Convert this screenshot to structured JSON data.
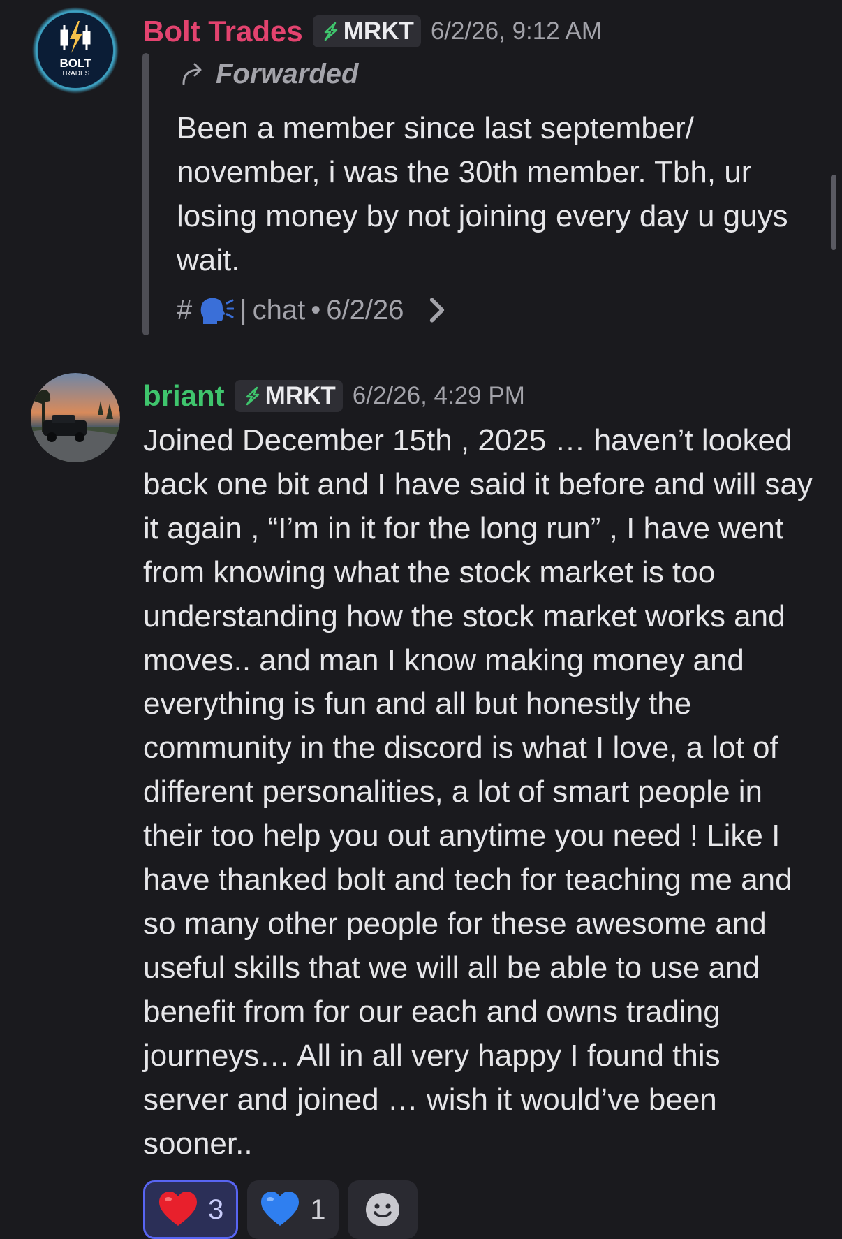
{
  "messages": [
    {
      "author": "Bolt Trades",
      "tag": "MRKT",
      "timestamp": "6/2/26, 9:12 AM",
      "avatar": {
        "line1": "BOLT",
        "line2": "TRADES"
      },
      "forwarded": {
        "label": "Forwarded",
        "body": "Been a member since last september/ november, i was the 30th member. Tbh, ur losing money by not joining every day u guys wait.",
        "source": {
          "prefix": "#",
          "separator": "|",
          "channel": "chat",
          "dot": "•",
          "date": "6/2/26"
        }
      }
    },
    {
      "author": "briant",
      "tag": "MRKT",
      "timestamp": "6/2/26, 4:29 PM",
      "body": "Joined December 15th , 2025 … haven’t looked back one bit and I have said it before and will say it again , “I’m in it for the long run” , I have went from knowing what the stock market is too understanding how the stock market works and moves.. and man I know making money and everything is fun and all but honestly the community in the discord is what I love, a lot of different personalities, a lot of smart people in their too help you out anytime you need ! Like I have thanked bolt and tech for teaching me and so many other people for these awesome and useful skills that we will all be able to use and benefit from for our each and owns trading journeys… All in all very happy I found this server and joined … wish it would’ve been sooner..",
      "reactions": [
        {
          "emoji": "red-heart",
          "count": "3",
          "active": true
        },
        {
          "emoji": "blue-heart",
          "count": "1",
          "active": false
        }
      ]
    }
  ],
  "colors": {
    "background": "#1a1a1e",
    "bolt_name": "#e3436f",
    "briant_name": "#3fc56d",
    "muted_text": "#a3a3aa",
    "accent": "#5865f2"
  }
}
